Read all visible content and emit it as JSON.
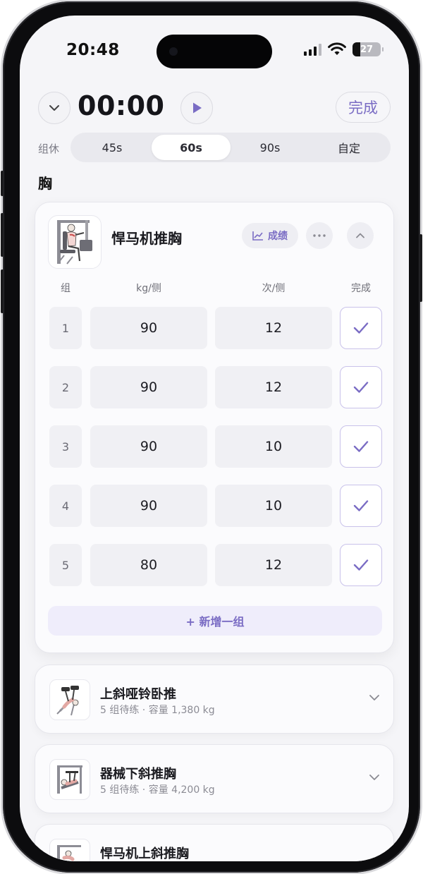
{
  "status_bar": {
    "time": "20:48",
    "battery": "27",
    "battery_level": 0.27
  },
  "timer": {
    "elapsed": "00:00",
    "done_label": "完成"
  },
  "rest": {
    "label": "组休",
    "options": [
      "45s",
      "60s",
      "90s",
      "自定"
    ],
    "selected": "60s"
  },
  "section": {
    "title": "胸"
  },
  "current_exercise": {
    "name": "悍马机推胸",
    "stats_label": "成绩",
    "columns": {
      "set": "组",
      "weight": "kg/侧",
      "reps": "次/侧",
      "done": "完成"
    },
    "sets": [
      {
        "no": "1",
        "weight": "90",
        "reps": "12",
        "done": true
      },
      {
        "no": "2",
        "weight": "90",
        "reps": "12",
        "done": true
      },
      {
        "no": "3",
        "weight": "90",
        "reps": "10",
        "done": true
      },
      {
        "no": "4",
        "weight": "90",
        "reps": "10",
        "done": true
      },
      {
        "no": "5",
        "weight": "80",
        "reps": "12",
        "done": true
      }
    ],
    "add_set_label": "+ 新增一组"
  },
  "other_exercises": [
    {
      "name": "上斜哑铃卧推",
      "summary": "5 组待练 · 容量 1,380 kg"
    },
    {
      "name": "器械下斜推胸",
      "summary": "5 组待练 · 容量 4,200 kg"
    },
    {
      "name": "悍马机上斜推胸",
      "summary": ""
    }
  ],
  "colors": {
    "accent": "#7a6cc4",
    "accent_soft": "#efedfb",
    "background": "#f5f5f8"
  },
  "icons": {
    "collapse": "chevron-down-icon",
    "play": "play-icon",
    "stats": "chart-line-icon",
    "more": "more-dots-icon",
    "card_collapse": "chevron-up-icon",
    "check": "check-icon"
  }
}
